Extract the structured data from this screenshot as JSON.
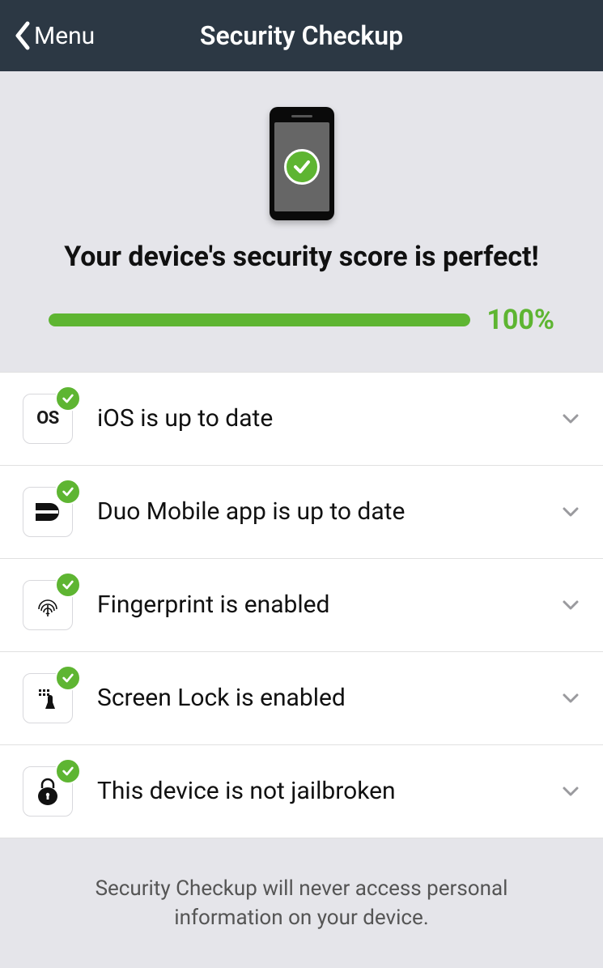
{
  "header": {
    "back_label": "Menu",
    "title": "Security Checkup"
  },
  "hero": {
    "title": "Your device's security score is perfect!",
    "progress_pct": "100%",
    "progress_value": 100
  },
  "items": [
    {
      "icon": "os",
      "label": "iOS is up to date",
      "status": "ok"
    },
    {
      "icon": "duo",
      "label": "Duo Mobile app is up to date",
      "status": "ok"
    },
    {
      "icon": "fingerprint",
      "label": "Fingerprint is enabled",
      "status": "ok"
    },
    {
      "icon": "screenlock",
      "label": "Screen Lock is enabled",
      "status": "ok"
    },
    {
      "icon": "lock",
      "label": "This device is not jailbroken",
      "status": "ok"
    }
  ],
  "footer": {
    "text": "Security Checkup will never access personal information on your device."
  },
  "colors": {
    "header_bg": "#2c3844",
    "accent_green": "#5eb532",
    "page_bg": "#e5e5ea"
  }
}
